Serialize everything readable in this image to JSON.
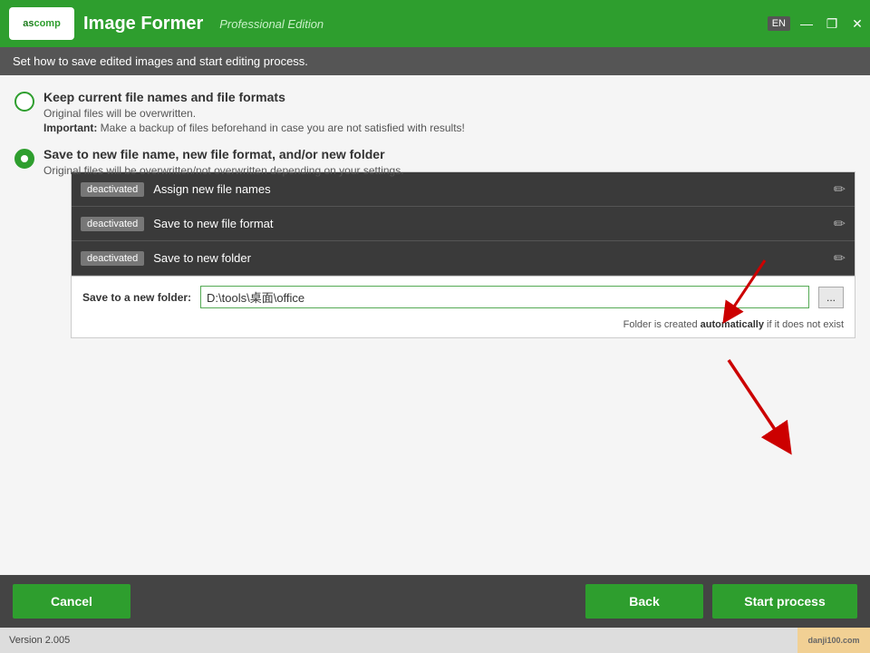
{
  "titlebar": {
    "logo_text": "ASCOMP",
    "app_name": "Image Former",
    "edition": "Professional Edition",
    "lang": "EN"
  },
  "window_controls": {
    "minimize": "—",
    "restore": "❐",
    "close": "✕"
  },
  "instruction_bar": {
    "text": "Set how to save edited images and start editing process."
  },
  "option1": {
    "label": "Keep current file names and file formats",
    "desc": "Original files will be overwritten.",
    "important_prefix": "Important:",
    "important_text": " Make a backup of files beforehand in case you are not satisfied with results!"
  },
  "option2": {
    "label": "Save to new file name, new file format, and/or new folder",
    "desc": "Original files will be overwritten/not overwritten depending on your settings."
  },
  "sub_options": [
    {
      "badge": "deactivated",
      "label": "Assign new file names"
    },
    {
      "badge": "deactivated",
      "label": "Save to new file format"
    },
    {
      "badge": "deactivated",
      "label": "Save to new folder"
    }
  ],
  "folder_section": {
    "label": "Save to a new folder:",
    "value": "D:\\tools\\桌面\\office",
    "hint_prefix": "Folder is created ",
    "hint_bold": "automatically",
    "hint_suffix": " if it does not exist",
    "browse_label": "..."
  },
  "buttons": {
    "cancel": "Cancel",
    "back": "Back",
    "start": "Start process"
  },
  "status": {
    "version": "Version 2.005"
  },
  "watermark": {
    "text": "danji100.com"
  }
}
